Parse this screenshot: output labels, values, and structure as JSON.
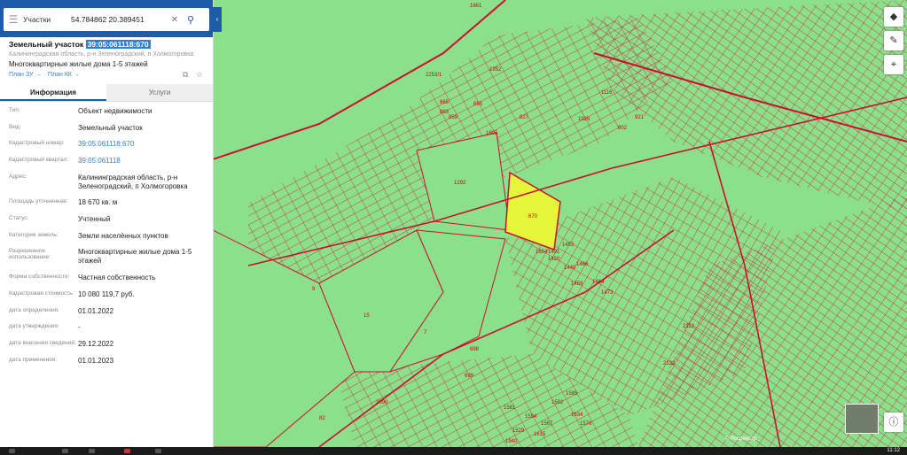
{
  "search": {
    "layer": "Участки",
    "query": "54.784862 20.389451"
  },
  "object": {
    "kind": "Земельный участок",
    "cadastral_number": "39:05:061118:670",
    "address_short": "Калининградская область, р-н Зеленоградский, п Холмогоровка",
    "use_short": "Многоквартирные жилые дома 1-5 этажей",
    "plan_zu": "План ЗУ →",
    "plan_kk": "План КК →"
  },
  "tabs": {
    "info": "Информация",
    "services": "Услуги"
  },
  "attributes": [
    {
      "label": "Тип:",
      "value": "Объект недвижимости"
    },
    {
      "label": "Вид:",
      "value": "Земельный участок"
    },
    {
      "label": "Кадастровый номер:",
      "value": "39:05:061118:670"
    },
    {
      "label": "Кадастровый квартал:",
      "value": "39:05:061118"
    },
    {
      "label": "Адрес:",
      "value": "Калининградская область, р-н Зеленоградский, п Холмогоровка"
    },
    {
      "label": "Площадь уточненная:",
      "value": "18 670 кв. м"
    },
    {
      "label": "Статус:",
      "value": "Учтенный"
    },
    {
      "label": "Категория земель:",
      "value": "Земли населённых пунктов"
    },
    {
      "label": "Разрешенное использование:",
      "value": "Многоквартирные жилые дома 1-5 этажей"
    },
    {
      "label": "Форма собственности:",
      "value": "Частная собственность"
    },
    {
      "label": "Кадастровая стоимость:",
      "value": "10 080 119,7 руб."
    },
    {
      "label": "дата определения:",
      "value": "01.01.2022"
    },
    {
      "label": "дата утверждения:",
      "value": "-"
    },
    {
      "label": "дата внесения сведений:",
      "value": "29.12.2022"
    },
    {
      "label": "дата применения:",
      "value": "01.01.2023"
    }
  ],
  "map": {
    "colors": {
      "fill": "#8ce08c",
      "boundary": "#c8102e",
      "selected": "#e5f53a"
    },
    "parcel_labels": [
      "1661",
      "1952",
      "2253/1",
      "1116",
      "1926",
      "1292",
      "670",
      "1905",
      "921",
      "902",
      "9",
      "15",
      "7",
      "699",
      "698",
      "2112",
      "2132",
      "1940",
      "82",
      "2090",
      "1420",
      "1491",
      "1440",
      "1459",
      "1464",
      "1473",
      "865",
      "863",
      "859",
      "655",
      "827",
      "1654",
      "1453",
      "1466",
      "1585",
      "1592",
      "1634",
      "1576",
      "1567",
      "1594",
      "1529",
      "1615",
      "1561"
    ],
    "scale": "2 км",
    "copyright": "© Росреестр"
  },
  "controls": {
    "layers": "layers-icon",
    "edit": "pencil-icon",
    "locate": "crosshair-icon",
    "info": "info-icon"
  },
  "taskbar": {
    "time": "11:12"
  }
}
